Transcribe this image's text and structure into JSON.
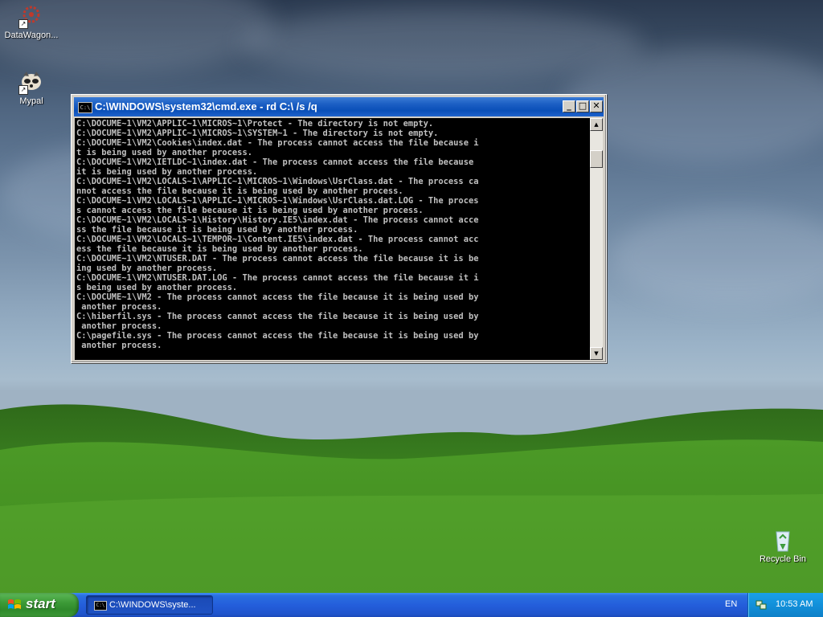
{
  "desktop": {
    "icons": [
      {
        "label": "DataWagon...",
        "icon": "datawagon-icon"
      },
      {
        "label": "Mypal",
        "icon": "mypal-icon"
      },
      {
        "label": "Recycle Bin",
        "icon": "recycle-bin-icon"
      }
    ]
  },
  "cmd_window": {
    "title": "C:\\WINDOWS\\system32\\cmd.exe - rd C:\\ /s /q",
    "icon_glyph": "C:\\",
    "buttons": {
      "minimize": "_",
      "maximize": "□",
      "close": "✕"
    },
    "lines": [
      "C:\\DOCUME~1\\VM2\\APPLIC~1\\MICROS~1\\Protect - The directory is not empty.",
      "C:\\DOCUME~1\\VM2\\APPLIC~1\\MICROS~1\\SYSTEM~1 - The directory is not empty.",
      "C:\\DOCUME~1\\VM2\\Cookies\\index.dat - The process cannot access the file because i",
      "t is being used by another process.",
      "C:\\DOCUME~1\\VM2\\IETLDC~1\\index.dat - The process cannot access the file because",
      "it is being used by another process.",
      "C:\\DOCUME~1\\VM2\\LOCALS~1\\APPLIC~1\\MICROS~1\\Windows\\UsrClass.dat - The process ca",
      "nnot access the file because it is being used by another process.",
      "C:\\DOCUME~1\\VM2\\LOCALS~1\\APPLIC~1\\MICROS~1\\Windows\\UsrClass.dat.LOG - The proces",
      "s cannot access the file because it is being used by another process.",
      "C:\\DOCUME~1\\VM2\\LOCALS~1\\History\\History.IE5\\index.dat - The process cannot acce",
      "ss the file because it is being used by another process.",
      "C:\\DOCUME~1\\VM2\\LOCALS~1\\TEMPOR~1\\Content.IE5\\index.dat - The process cannot acc",
      "ess the file because it is being used by another process.",
      "C:\\DOCUME~1\\VM2\\NTUSER.DAT - The process cannot access the file because it is be",
      "ing used by another process.",
      "C:\\DOCUME~1\\VM2\\NTUSER.DAT.LOG - The process cannot access the file because it i",
      "s being used by another process.",
      "C:\\DOCUME~1\\VM2 - The process cannot access the file because it is being used by",
      " another process.",
      "C:\\hiberfil.sys - The process cannot access the file because it is being used by",
      " another process.",
      "C:\\pagefile.sys - The process cannot access the file because it is being used by",
      " another process."
    ]
  },
  "taskbar": {
    "start_label": "start",
    "task_item_label": "C:\\WINDOWS\\syste...",
    "language": "EN",
    "clock": "10:53 AM"
  },
  "colors": {
    "console_bg": "#000000",
    "console_fg": "#c0c0c0",
    "titlebar": "#0a4fb8",
    "taskbar": "#245edb",
    "start_green": "#3c9a37",
    "tray": "#1290da"
  }
}
